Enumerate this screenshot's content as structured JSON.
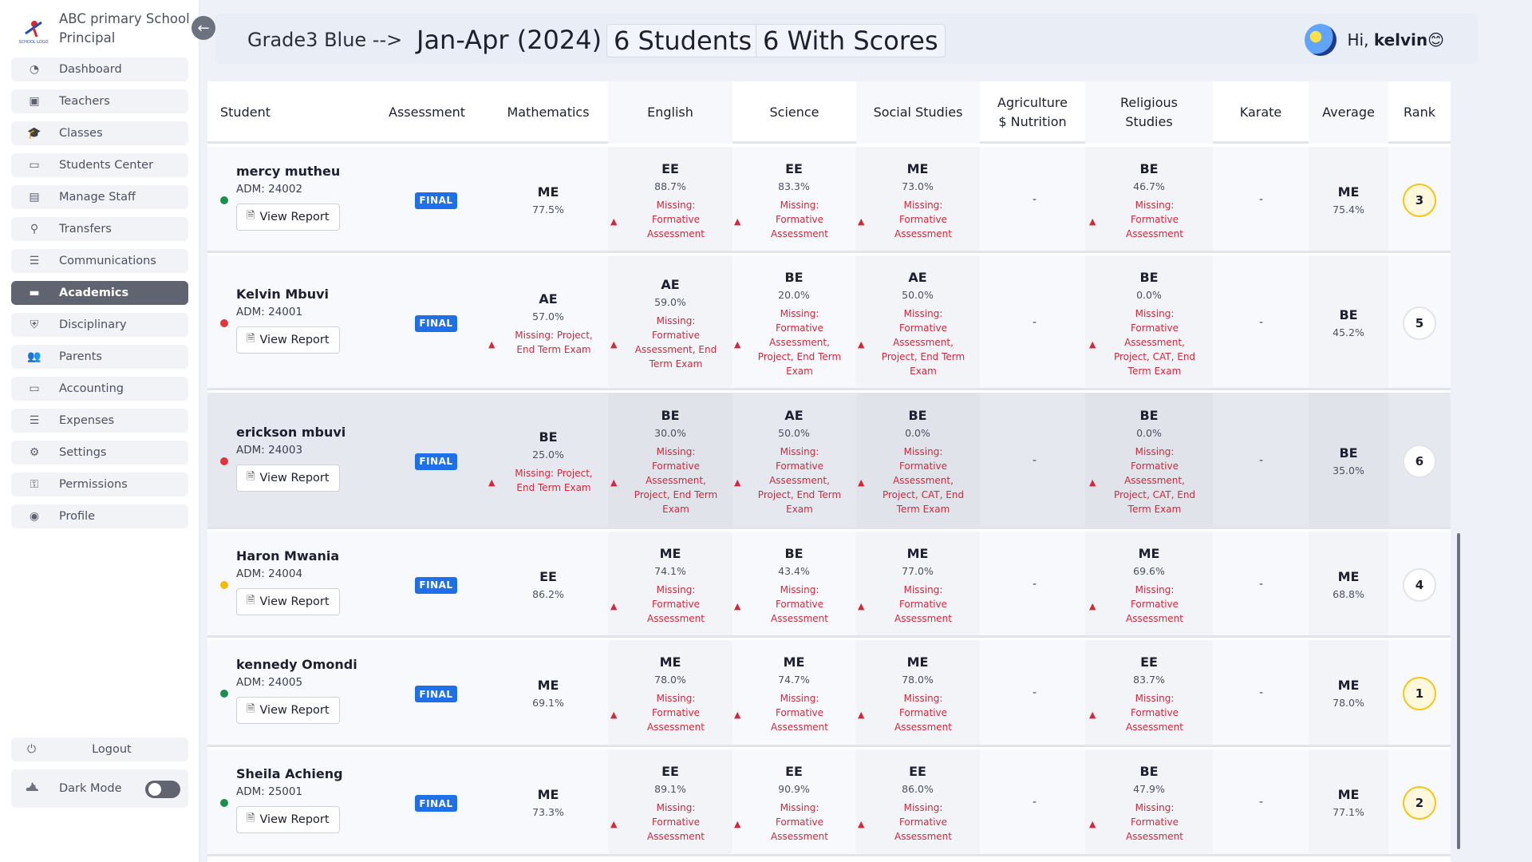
{
  "sidebar": {
    "brand_line1": "ABC primary School",
    "brand_line2": "Principal",
    "logo_text": "SCHOOL LOGO",
    "items": [
      {
        "label": "Dashboard",
        "icon": "gauge-icon"
      },
      {
        "label": "Teachers",
        "icon": "teacher-icon"
      },
      {
        "label": "Classes",
        "icon": "graduation-cap-icon"
      },
      {
        "label": "Students Center",
        "icon": "monitor-user-icon"
      },
      {
        "label": "Manage Staff",
        "icon": "id-card-icon"
      },
      {
        "label": "Transfers",
        "icon": "user-transfer-icon"
      },
      {
        "label": "Communications",
        "icon": "document-list-icon"
      },
      {
        "label": "Academics",
        "icon": "book-open-icon"
      },
      {
        "label": "Disciplinary",
        "icon": "shield-icon"
      },
      {
        "label": "Parents",
        "icon": "users-icon"
      },
      {
        "label": "Accounting",
        "icon": "money-icon"
      },
      {
        "label": "Expenses",
        "icon": "receipt-icon"
      },
      {
        "label": "Settings",
        "icon": "gear-icon"
      },
      {
        "label": "Permissions",
        "icon": "key-icon"
      },
      {
        "label": "Profile",
        "icon": "user-circle-icon"
      }
    ],
    "active_item": "Academics",
    "logout_label": "Logout",
    "darkmode_label": "Dark Mode",
    "darkmode_on": false
  },
  "header": {
    "class_crumb": "Grade3 Blue -->",
    "period": "Jan-Apr (2024)",
    "students_chip": "6 Students",
    "scores_chip": "6 With Scores",
    "greeting": "Hi,",
    "username": "kelvin",
    "emoji": "😊"
  },
  "table": {
    "headers": {
      "student": "Student",
      "assessment": "Assessment",
      "mathematics": "Mathematics",
      "english": "English",
      "science": "Science",
      "social": "Social Studies",
      "agri_line1": "Agriculture",
      "agri_line2": "$ Nutrition",
      "rel_line1": "Religious",
      "rel_line2": "Studies",
      "karate": "Karate",
      "average": "Average",
      "rank": "Rank"
    },
    "view_report_label": "View Report",
    "final_label": "FINAL",
    "empty_mark": "-",
    "status_colors": {
      "green": "#1e8e4e",
      "red": "#e0343f",
      "yellow": "#f5b90b"
    },
    "rows": [
      {
        "name": "mercy mutheu",
        "adm": "ADM: 24002",
        "status": "green",
        "math": {
          "grade": "ME",
          "pct": "77.5%",
          "missing": ""
        },
        "english": {
          "grade": "EE",
          "pct": "88.7%",
          "missing": [
            "Missing:",
            "Formative",
            "Assessment"
          ]
        },
        "science": {
          "grade": "EE",
          "pct": "83.3%",
          "missing": [
            "Missing:",
            "Formative",
            "Assessment"
          ]
        },
        "social": {
          "grade": "ME",
          "pct": "73.0%",
          "missing": [
            "Missing:",
            "Formative",
            "Assessment"
          ]
        },
        "religious": {
          "grade": "BE",
          "pct": "46.7%",
          "missing": [
            "Missing:",
            "Formative",
            "Assessment"
          ]
        },
        "average": {
          "grade": "ME",
          "pct": "75.4%"
        },
        "rank": "3",
        "rank_gold": true
      },
      {
        "name": "Kelvin Mbuvi",
        "adm": "ADM: 24001",
        "status": "red",
        "math": {
          "grade": "AE",
          "pct": "57.0%",
          "missing": [
            "Missing: Project,",
            "End Term Exam"
          ]
        },
        "english": {
          "grade": "AE",
          "pct": "59.0%",
          "missing": [
            "Missing:",
            "Formative",
            "Assessment, End",
            "Term Exam"
          ]
        },
        "science": {
          "grade": "BE",
          "pct": "20.0%",
          "missing": [
            "Missing:",
            "Formative",
            "Assessment,",
            "Project, End Term",
            "Exam"
          ]
        },
        "social": {
          "grade": "AE",
          "pct": "50.0%",
          "missing": [
            "Missing:",
            "Formative",
            "Assessment,",
            "Project, End Term",
            "Exam"
          ]
        },
        "religious": {
          "grade": "BE",
          "pct": "0.0%",
          "missing": [
            "Missing:",
            "Formative",
            "Assessment,",
            "Project, CAT, End",
            "Term Exam"
          ]
        },
        "average": {
          "grade": "BE",
          "pct": "45.2%"
        },
        "rank": "5",
        "rank_gold": false
      },
      {
        "name": "erickson mbuvi",
        "adm": "ADM: 24003",
        "status": "red",
        "math": {
          "grade": "BE",
          "pct": "25.0%",
          "missing": [
            "Missing: Project,",
            "End Term Exam"
          ]
        },
        "english": {
          "grade": "BE",
          "pct": "30.0%",
          "missing": [
            "Missing:",
            "Formative",
            "Assessment,",
            "Project, End Term",
            "Exam"
          ]
        },
        "science": {
          "grade": "AE",
          "pct": "50.0%",
          "missing": [
            "Missing:",
            "Formative",
            "Assessment,",
            "Project, End Term",
            "Exam"
          ]
        },
        "social": {
          "grade": "BE",
          "pct": "0.0%",
          "missing": [
            "Missing:",
            "Formative",
            "Assessment,",
            "Project, CAT, End",
            "Term Exam"
          ]
        },
        "religious": {
          "grade": "BE",
          "pct": "0.0%",
          "missing": [
            "Missing:",
            "Formative",
            "Assessment,",
            "Project, CAT, End",
            "Term Exam"
          ]
        },
        "average": {
          "grade": "BE",
          "pct": "35.0%"
        },
        "rank": "6",
        "rank_gold": false
      },
      {
        "name": "Haron Mwania",
        "adm": "ADM: 24004",
        "status": "yellow",
        "math": {
          "grade": "EE",
          "pct": "86.2%",
          "missing": ""
        },
        "english": {
          "grade": "ME",
          "pct": "74.1%",
          "missing": [
            "Missing:",
            "Formative",
            "Assessment"
          ]
        },
        "science": {
          "grade": "BE",
          "pct": "43.4%",
          "missing": [
            "Missing:",
            "Formative",
            "Assessment"
          ]
        },
        "social": {
          "grade": "ME",
          "pct": "77.0%",
          "missing": [
            "Missing:",
            "Formative",
            "Assessment"
          ]
        },
        "religious": {
          "grade": "ME",
          "pct": "69.6%",
          "missing": [
            "Missing:",
            "Formative",
            "Assessment"
          ]
        },
        "average": {
          "grade": "ME",
          "pct": "68.8%"
        },
        "rank": "4",
        "rank_gold": false
      },
      {
        "name": "kennedy Omondi",
        "adm": "ADM: 24005",
        "status": "green",
        "math": {
          "grade": "ME",
          "pct": "69.1%",
          "missing": ""
        },
        "english": {
          "grade": "ME",
          "pct": "78.0%",
          "missing": [
            "Missing:",
            "Formative",
            "Assessment"
          ]
        },
        "science": {
          "grade": "ME",
          "pct": "74.7%",
          "missing": [
            "Missing:",
            "Formative",
            "Assessment"
          ]
        },
        "social": {
          "grade": "ME",
          "pct": "78.0%",
          "missing": [
            "Missing:",
            "Formative",
            "Assessment"
          ]
        },
        "religious": {
          "grade": "EE",
          "pct": "83.7%",
          "missing": [
            "Missing:",
            "Formative",
            "Assessment"
          ]
        },
        "average": {
          "grade": "ME",
          "pct": "78.0%"
        },
        "rank": "1",
        "rank_gold": true
      },
      {
        "name": "Sheila Achieng",
        "adm": "ADM: 25001",
        "status": "green",
        "math": {
          "grade": "ME",
          "pct": "73.3%",
          "missing": ""
        },
        "english": {
          "grade": "EE",
          "pct": "89.1%",
          "missing": [
            "Missing:",
            "Formative",
            "Assessment"
          ]
        },
        "science": {
          "grade": "EE",
          "pct": "90.9%",
          "missing": [
            "Missing:",
            "Formative",
            "Assessment"
          ]
        },
        "social": {
          "grade": "EE",
          "pct": "86.0%",
          "missing": [
            "Missing:",
            "Formative",
            "Assessment"
          ]
        },
        "religious": {
          "grade": "BE",
          "pct": "47.9%",
          "missing": [
            "Missing:",
            "Formative",
            "Assessment"
          ]
        },
        "average": {
          "grade": "ME",
          "pct": "77.1%"
        },
        "rank": "2",
        "rank_gold": true
      }
    ]
  }
}
